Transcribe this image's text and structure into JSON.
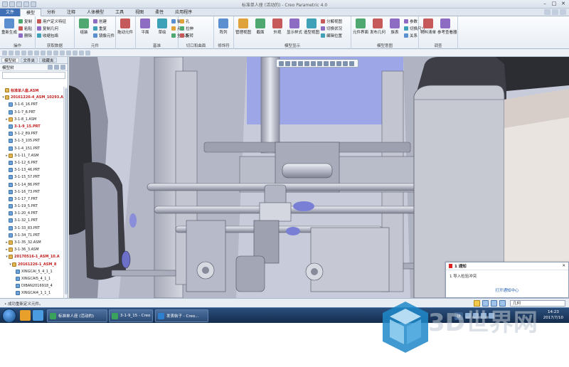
{
  "window": {
    "title": "标准单人座 (活动的) - Creo Parametric 4.0"
  },
  "tabs": [
    "文件",
    "模型",
    "分析",
    "注释",
    "人体模型",
    "工具",
    "视图",
    "柔性",
    "应用程序"
  ],
  "active_tab": "模型",
  "ribbon": {
    "groups": [
      {
        "label": "操作",
        "big": [
          "重新生成"
        ],
        "small": [
          "复制",
          "粘贴",
          "删除"
        ]
      },
      {
        "label": "获取数据",
        "small": [
          "用户定义特征",
          "复制几何",
          "收缩包络"
        ]
      },
      {
        "label": "元件",
        "big": [
          "组装"
        ],
        "small": [
          "创建",
          "重复",
          "镜像元件"
        ]
      },
      {
        "label": "",
        "big": [
          "拖动元件"
        ]
      },
      {
        "label": "基准",
        "big": [
          "平面",
          "草绘"
        ],
        "small": [
          "轴",
          "点",
          "坐标系"
        ]
      },
      {
        "label": "切口和曲面",
        "small": [
          "孔",
          "拉伸",
          "旋转"
        ]
      },
      {
        "label": "修饰符",
        "big": [
          "阵列"
        ]
      },
      {
        "label": "模型显示",
        "big": [
          "管理视图",
          "截面",
          "外观",
          "显示样式",
          "造型视图"
        ],
        "small": [
          "分解视图",
          "切换状况",
          "编辑位置"
        ]
      },
      {
        "label": "模型意图",
        "big": [
          "元件界面",
          "发布几何",
          "族表"
        ],
        "small": [
          "参数",
          "切换尺寸",
          "关系"
        ]
      },
      {
        "label": "调查",
        "big": [
          "物料清单",
          "参考查看器"
        ]
      }
    ]
  },
  "left_pane": {
    "tabs": [
      "模型树",
      "文件夹",
      "收藏夹"
    ],
    "header": "模型树",
    "tree": [
      {
        "label": "标准单人座.ASM",
        "type": "asm",
        "red": true,
        "indent": 0,
        "exp": ""
      },
      {
        "label": "20161226-4_ASM_10293.A",
        "type": "asm",
        "red": true,
        "indent": 0,
        "exp": "▾"
      },
      {
        "label": "3-1-6_16.PRT",
        "type": "prt",
        "red": false,
        "indent": 1,
        "exp": ""
      },
      {
        "label": "3-1-7_8.PRT",
        "type": "prt",
        "red": false,
        "indent": 1,
        "exp": ""
      },
      {
        "label": "3-1-8_1.ASM",
        "type": "asm",
        "red": false,
        "indent": 1,
        "exp": "▸"
      },
      {
        "label": "3-1-9_15.PRT",
        "type": "prt",
        "red": true,
        "indent": 1,
        "exp": ""
      },
      {
        "label": "3-1-2_89.PRT",
        "type": "prt",
        "red": false,
        "indent": 1,
        "exp": ""
      },
      {
        "label": "3-1-3_105.PRT",
        "type": "prt",
        "red": false,
        "indent": 1,
        "exp": ""
      },
      {
        "label": "3-1-4_151.PRT",
        "type": "prt",
        "red": false,
        "indent": 1,
        "exp": ""
      },
      {
        "label": "3-1-11_7.ASM",
        "type": "asm",
        "red": false,
        "indent": 1,
        "exp": "▸"
      },
      {
        "label": "3-1-12_6.PRT",
        "type": "prt",
        "red": false,
        "indent": 1,
        "exp": ""
      },
      {
        "label": "3-1-13_46.PRT",
        "type": "prt",
        "red": false,
        "indent": 1,
        "exp": ""
      },
      {
        "label": "3-1-15_57.PRT",
        "type": "prt",
        "red": false,
        "indent": 1,
        "exp": ""
      },
      {
        "label": "3-1-14_86.PRT",
        "type": "prt",
        "red": false,
        "indent": 1,
        "exp": ""
      },
      {
        "label": "3-1-16_73.PRT",
        "type": "prt",
        "red": false,
        "indent": 1,
        "exp": ""
      },
      {
        "label": "3-1-17_7.PRT",
        "type": "prt",
        "red": false,
        "indent": 1,
        "exp": ""
      },
      {
        "label": "3-1-19_5.PRT",
        "type": "prt",
        "red": false,
        "indent": 1,
        "exp": ""
      },
      {
        "label": "3-1-20_4.PRT",
        "type": "prt",
        "red": false,
        "indent": 1,
        "exp": ""
      },
      {
        "label": "3-1-32_1.PRT",
        "type": "prt",
        "red": false,
        "indent": 1,
        "exp": ""
      },
      {
        "label": "3-1-33_83.PRT",
        "type": "prt",
        "red": false,
        "indent": 1,
        "exp": ""
      },
      {
        "label": "3-1-34_71.PRT",
        "type": "prt",
        "red": false,
        "indent": 1,
        "exp": ""
      },
      {
        "label": "3-1-35_32.ASM",
        "type": "asm",
        "red": false,
        "indent": 1,
        "exp": "▸"
      },
      {
        "label": "3-1-36_3.ASM",
        "type": "asm",
        "red": false,
        "indent": 1,
        "exp": "▸"
      },
      {
        "label": "20170516-1_ASM_10.A",
        "type": "asm",
        "red": true,
        "indent": 1,
        "exp": "▾"
      },
      {
        "label": "20161226-1_ASM_8",
        "type": "asm",
        "red": true,
        "indent": 2,
        "exp": "▾"
      },
      {
        "label": "XINGCAI_5_4_1_1",
        "type": "prt",
        "red": false,
        "indent": 3,
        "exp": ""
      },
      {
        "label": "XINGCAI5_4_1_1",
        "type": "prt",
        "red": false,
        "indent": 3,
        "exp": ""
      },
      {
        "label": "DIBAN2016918_4",
        "type": "prt",
        "red": false,
        "indent": 3,
        "exp": ""
      },
      {
        "label": "XINGCAI4_1_1_1",
        "type": "prt",
        "red": false,
        "indent": 3,
        "exp": ""
      }
    ]
  },
  "notification": {
    "title": "1 通知",
    "close": "✕",
    "body": "1 导入检验冲突",
    "link": "打开通知中心"
  },
  "status": {
    "message": "• 成功重新定义元件。",
    "filter": "几何"
  },
  "taskbar": {
    "items": [
      {
        "label": "标准单人座 (活动的)",
        "color": "#3aa35b"
      },
      {
        "label": "3-1-9_15 - Creo",
        "color": "#3aa35b"
      },
      {
        "label": "发表帖子 - Creo...",
        "color": "#2f7fd1"
      }
    ],
    "ime": "拼",
    "time": "14:23",
    "date": "2017/7/10"
  },
  "watermark": {
    "text": "3D世界网"
  },
  "colors": {
    "accent": "#3f6fb5",
    "selection_red": "#c21b1b",
    "viewport_bg": "#c7cad8"
  }
}
